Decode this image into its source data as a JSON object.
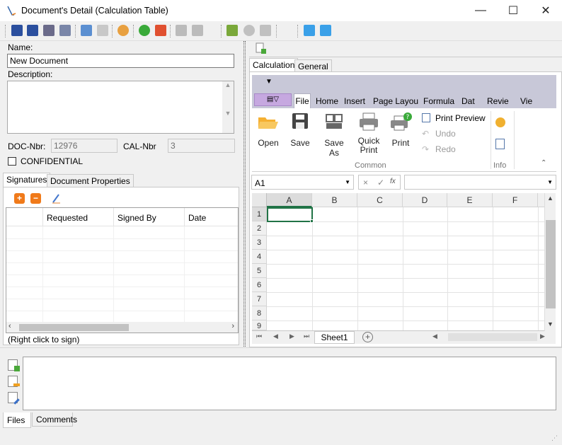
{
  "window": {
    "title": "Document's Detail (Calculation Table)",
    "min": "—",
    "max": "☐",
    "close": "✕"
  },
  "form": {
    "name_label": "Name:",
    "name_value": "New Document",
    "description_label": "Description:",
    "doc_nbr_label": "DOC-Nbr:",
    "doc_nbr_value": "12976",
    "cal_nbr_label": "CAL-Nbr",
    "cal_nbr_value": "3",
    "confidential_label": "CONFIDENTIAL"
  },
  "left_tabs": [
    "Signatures",
    "Document Properties"
  ],
  "signatures": {
    "columns": [
      "Requested",
      "Signed By",
      "Date"
    ],
    "hint": "(Right click to sign)"
  },
  "right_tabs": [
    "Calculation",
    "General"
  ],
  "ribbon": {
    "tabs": [
      "File",
      "Home",
      "Insert",
      "Page Layou",
      "Formula",
      "Dat",
      "Revie",
      "Vie"
    ],
    "buttons": {
      "open": "Open",
      "save": "Save",
      "save_as": "Save As",
      "quick_print_1": "Quick",
      "quick_print_2": "Print",
      "print": "Print",
      "print_preview": "Print Preview",
      "undo": "Undo",
      "redo": "Redo"
    },
    "groups": {
      "common": "Common",
      "info": "Info"
    }
  },
  "formula_bar": {
    "cell_ref": "A1",
    "cancel": "×",
    "confirm": "✓",
    "fx": "fx"
  },
  "sheet": {
    "columns": [
      "A",
      "B",
      "C",
      "D",
      "E",
      "F"
    ],
    "rows": [
      "1",
      "2",
      "3",
      "4",
      "5",
      "6",
      "7",
      "8",
      "9"
    ],
    "sheet_tab": "Sheet1"
  },
  "bottom_tabs": [
    "Files",
    "Comments"
  ]
}
